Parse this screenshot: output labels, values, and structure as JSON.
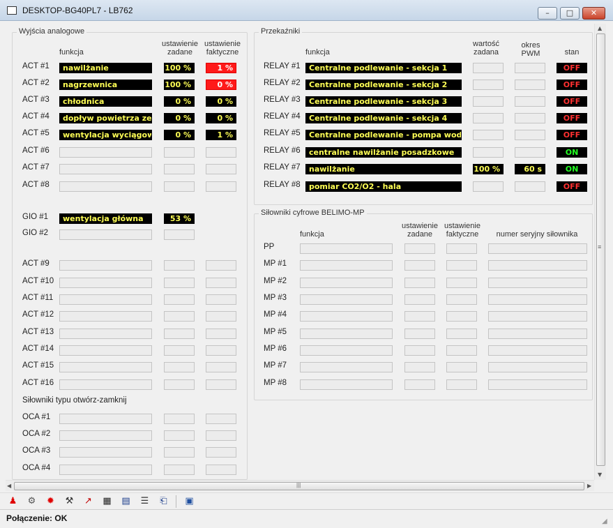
{
  "window": {
    "title": "DESKTOP-BG40PL7 - LB762",
    "min": "–",
    "max": "□",
    "close": "✕"
  },
  "analog": {
    "title": "Wyjścia analogowe",
    "hdr_funkcja": "funkcja",
    "hdr_zadane": "ustawienie zadane",
    "hdr_faktyczne": "ustawienie faktyczne",
    "act": [
      {
        "name": "ACT #1",
        "funkcja": "nawilżanie",
        "zadane": "100 %",
        "faktyczne": "1 %",
        "fakt_alarm": true
      },
      {
        "name": "ACT #2",
        "funkcja": "nagrzewnica",
        "zadane": "100 %",
        "faktyczne": "0 %",
        "fakt_alarm": true
      },
      {
        "name": "ACT #3",
        "funkcja": "chłodnica",
        "zadane": "0 %",
        "faktyczne": "0 %",
        "fakt_alarm": false
      },
      {
        "name": "ACT #4",
        "funkcja": "dopływ powietrza zewn",
        "zadane": "0 %",
        "faktyczne": "0 %",
        "fakt_alarm": false
      },
      {
        "name": "ACT #5",
        "funkcja": "wentylacja wyciągowa",
        "zadane": "0 %",
        "faktyczne": "1 %",
        "fakt_alarm": false
      },
      {
        "name": "ACT #6",
        "funkcja": "",
        "zadane": "",
        "faktyczne": ""
      },
      {
        "name": "ACT #7",
        "funkcja": "",
        "zadane": "",
        "faktyczne": ""
      },
      {
        "name": "ACT #8",
        "funkcja": "",
        "zadane": "",
        "faktyczne": ""
      }
    ],
    "gio": [
      {
        "name": "GIO #1",
        "funkcja": "wentylacja główna",
        "zadane": "53 %"
      },
      {
        "name": "GIO #2",
        "funkcja": "",
        "zadane": ""
      }
    ],
    "act2": [
      "ACT #9",
      "ACT #10",
      "ACT #11",
      "ACT #12",
      "ACT #13",
      "ACT #14",
      "ACT #15",
      "ACT #16"
    ],
    "oca_title": "Siłowniki typu otwórz-zamknij",
    "oca": [
      "OCA #1",
      "OCA #2",
      "OCA #3",
      "OCA #4"
    ]
  },
  "relays": {
    "title": "Przekaźniki",
    "hdr_funkcja": "funkcja",
    "hdr_wartosc": "wartość zadana",
    "hdr_pwm": "okres PWM",
    "hdr_stan": "stan",
    "items": [
      {
        "name": "RELAY #1",
        "funkcja": "Centralne podlewanie - sekcja 1",
        "wartosc": "",
        "pwm": "",
        "stan": "OFF"
      },
      {
        "name": "RELAY #2",
        "funkcja": "Centralne podlewanie - sekcja 2",
        "wartosc": "",
        "pwm": "",
        "stan": "OFF"
      },
      {
        "name": "RELAY #3",
        "funkcja": "Centralne podlewanie - sekcja 3",
        "wartosc": "",
        "pwm": "",
        "stan": "OFF"
      },
      {
        "name": "RELAY #4",
        "funkcja": "Centralne podlewanie - sekcja 4",
        "wartosc": "",
        "pwm": "",
        "stan": "OFF"
      },
      {
        "name": "RELAY #5",
        "funkcja": "Centralne podlewanie - pompa wody",
        "wartosc": "",
        "pwm": "",
        "stan": "OFF"
      },
      {
        "name": "RELAY #6",
        "funkcja": "centralne nawilżanie posadzkowe",
        "wartosc": "",
        "pwm": "",
        "stan": "ON"
      },
      {
        "name": "RELAY #7",
        "funkcja": "nawilżanie",
        "wartosc": "100 %",
        "pwm": "60 s",
        "stan": "ON"
      },
      {
        "name": "RELAY #8",
        "funkcja": "pomiar CO2/O2 - hala",
        "wartosc": "",
        "pwm": "",
        "stan": "OFF"
      }
    ]
  },
  "belimo": {
    "title": "Siłowniki cyfrowe BELIMO-MP",
    "hdr_funkcja": "funkcja",
    "hdr_zadane": "ustawienie zadane",
    "hdr_faktyczne": "ustawienie faktyczne",
    "hdr_serial": "numer seryjny siłownika",
    "items": [
      "PP",
      "MP #1",
      "MP #2",
      "MP #3",
      "MP #4",
      "MP #5",
      "MP #6",
      "MP #7",
      "MP #8"
    ]
  },
  "scroll": {
    "grip": "≡",
    "hgrip": "|||",
    "up": "▲",
    "down": "▼",
    "left": "◀",
    "right": "▶"
  },
  "toolbar": {
    "icons": [
      {
        "name": "alarm-light-icon",
        "glyph": "♟",
        "color": "#e00000"
      },
      {
        "name": "settings-gear-icon",
        "glyph": "⚙",
        "color": "#555555"
      },
      {
        "name": "red-gear-icon",
        "glyph": "✹",
        "color": "#e00000"
      },
      {
        "name": "tools-icon",
        "glyph": "⚒",
        "color": "#333333"
      },
      {
        "name": "line-chart-icon",
        "glyph": "↗",
        "color": "#c00000"
      },
      {
        "name": "table-grid-icon",
        "glyph": "▦",
        "color": "#222222"
      },
      {
        "name": "book-icon",
        "glyph": "▤",
        "color": "#1a3c8a"
      },
      {
        "name": "document-list-icon",
        "glyph": "☰",
        "color": "#333333"
      },
      {
        "name": "open-book-icon",
        "glyph": "⎗",
        "color": "#1a3c8a"
      },
      {
        "name": "monitor-icon",
        "glyph": "▣",
        "color": "#2050a0"
      }
    ]
  },
  "status": {
    "connection": "Połączenie: OK"
  }
}
